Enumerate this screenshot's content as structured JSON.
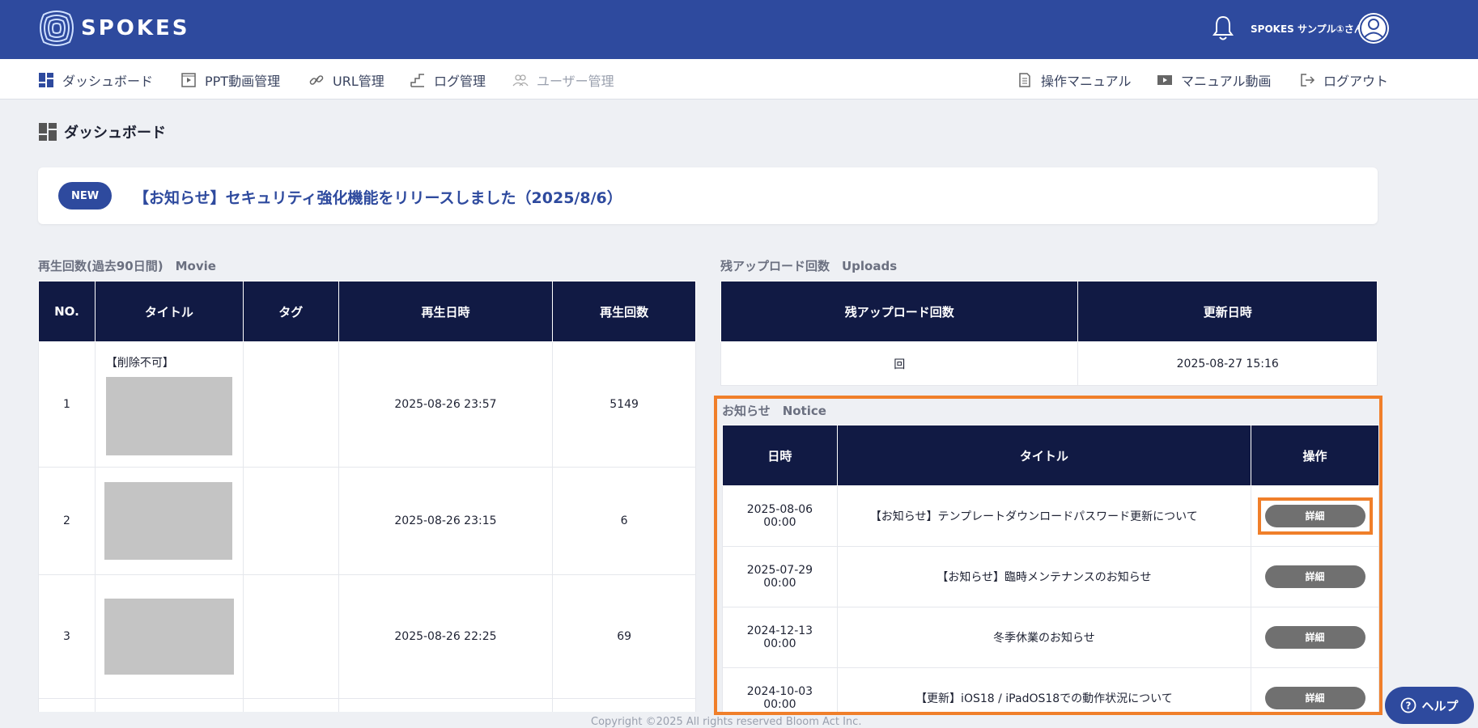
{
  "header": {
    "logo_text": "SPOKES",
    "user_name": "SPOKES サンプル①さん"
  },
  "nav": {
    "left": [
      {
        "label": "ダッシュボード",
        "icon": "dashboard-icon"
      },
      {
        "label": "PPT動画管理",
        "icon": "video-file-icon"
      },
      {
        "label": "URL管理",
        "icon": "link-icon"
      },
      {
        "label": "ログ管理",
        "icon": "stairs-icon"
      },
      {
        "label": "ユーザー管理",
        "icon": "users-icon"
      }
    ],
    "right": [
      {
        "label": "操作マニュアル",
        "icon": "document-icon"
      },
      {
        "label": "マニュアル動画",
        "icon": "film-icon"
      },
      {
        "label": "ログアウト",
        "icon": "logout-icon"
      }
    ]
  },
  "page_title": "ダッシュボード",
  "announcement": {
    "badge": "NEW",
    "text": "【お知らせ】セキュリティ強化機能をリリースしました（2025/8/6）"
  },
  "movie": {
    "label": "再生回数(過去90日間)　Movie",
    "headers": [
      "NO.",
      "タイトル",
      "タグ",
      "再生日時",
      "再生回数"
    ],
    "rows": [
      {
        "no": "1",
        "title_text": "【削除不可】",
        "tag": "",
        "date": "2025-08-26 23:57",
        "count": "5149"
      },
      {
        "no": "2",
        "title_text": "",
        "tag": "",
        "date": "2025-08-26 23:15",
        "count": "6"
      },
      {
        "no": "3",
        "title_text": "",
        "tag": "",
        "date": "2025-08-26 22:25",
        "count": "69"
      }
    ]
  },
  "uploads": {
    "label": "残アップロード回数　Uploads",
    "headers": [
      "残アップロード回数",
      "更新日時"
    ],
    "row": {
      "remaining": "回",
      "updated": "2025-08-27 15:16"
    }
  },
  "notice": {
    "label": "お知らせ　Notice",
    "headers": [
      "日時",
      "タイトル",
      "操作"
    ],
    "rows": [
      {
        "date": "2025-08-06",
        "time": "00:00",
        "title": "【お知らせ】テンプレートダウンロードパスワード更新について",
        "button": "詳細"
      },
      {
        "date": "2025-07-29",
        "time": "00:00",
        "title": "【お知らせ】臨時メンテナンスのお知らせ",
        "button": "詳細"
      },
      {
        "date": "2024-12-13",
        "time": "00:00",
        "title": "冬季休業のお知らせ",
        "button": "詳細"
      },
      {
        "date": "2024-10-03",
        "time": "00:00",
        "title": "【更新】iOS18 / iPadOS18での動作状況について",
        "button": "詳細"
      }
    ]
  },
  "footer": "Copyright ©2025 All rights reserved Bloom Act Inc.",
  "help_label": "ヘルプ",
  "colors": {
    "brand": "#2e4a9e",
    "table_header": "#111a44",
    "highlight": "#f07f2a"
  }
}
